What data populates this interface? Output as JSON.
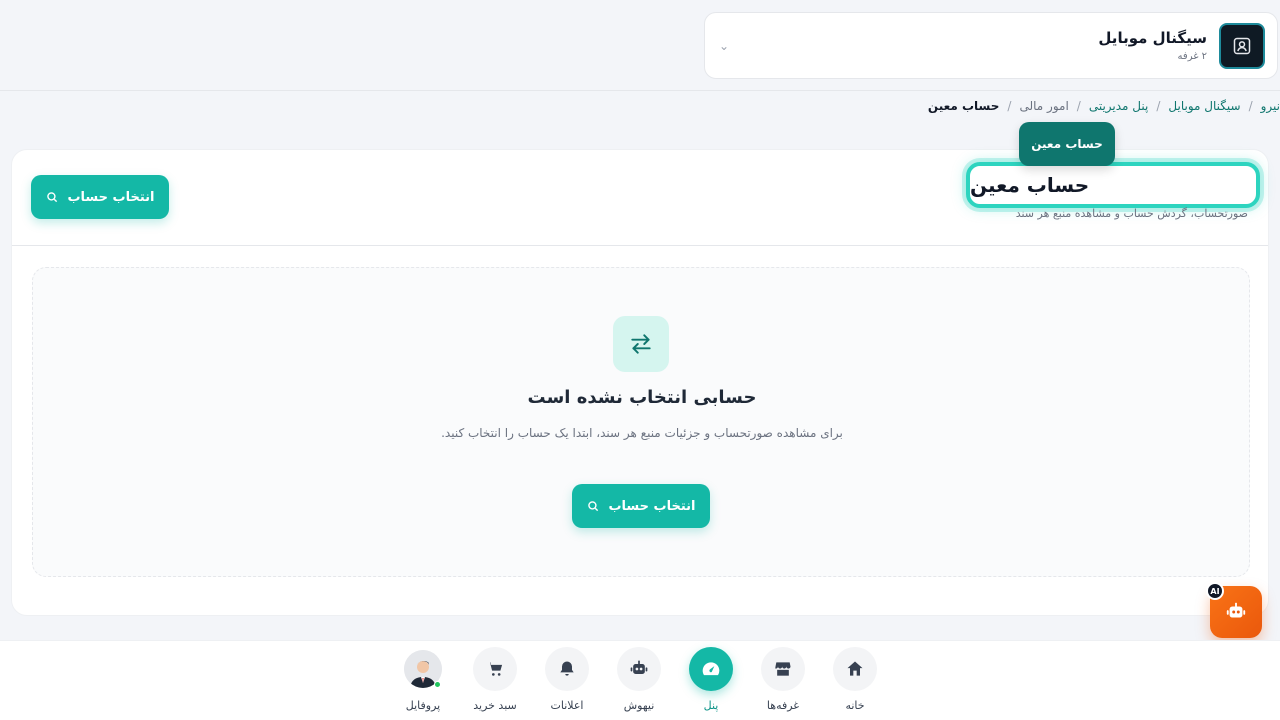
{
  "store": {
    "name": "سیگنال موبایل",
    "sub": "۲ غرفه",
    "chevron": "⌄"
  },
  "breadcrumb": {
    "items": [
      "نیرو",
      "سیگنال موبایل",
      "پنل مدیریتی",
      "امور مالی",
      "حساب معین"
    ],
    "separator": "/"
  },
  "header": {
    "title": "حساب معین",
    "subtitle": "صورتحساب، گردش حساب و مشاهده منبع هر سند",
    "tooltip": "حساب معین",
    "select_button": "انتخاب حساب"
  },
  "empty_state": {
    "title": "حسابی انتخاب نشده است",
    "description": "برای مشاهده صورتحساب و جزئیات منبع هر سند، ابتدا یک حساب را انتخاب کنید.",
    "button": "انتخاب حساب"
  },
  "ai": {
    "badge": "AI"
  },
  "nav": {
    "home": "خانه",
    "booths": "غرفه‌ها",
    "panel": "پنل",
    "nihoosh": "نیهوش",
    "notifications": "اعلانات",
    "cart": "سبد خرید",
    "profile": "پروفایل"
  },
  "colors": {
    "accent": "#14b8a6",
    "accent_dark": "#0f766e",
    "ai": "#f97316"
  }
}
